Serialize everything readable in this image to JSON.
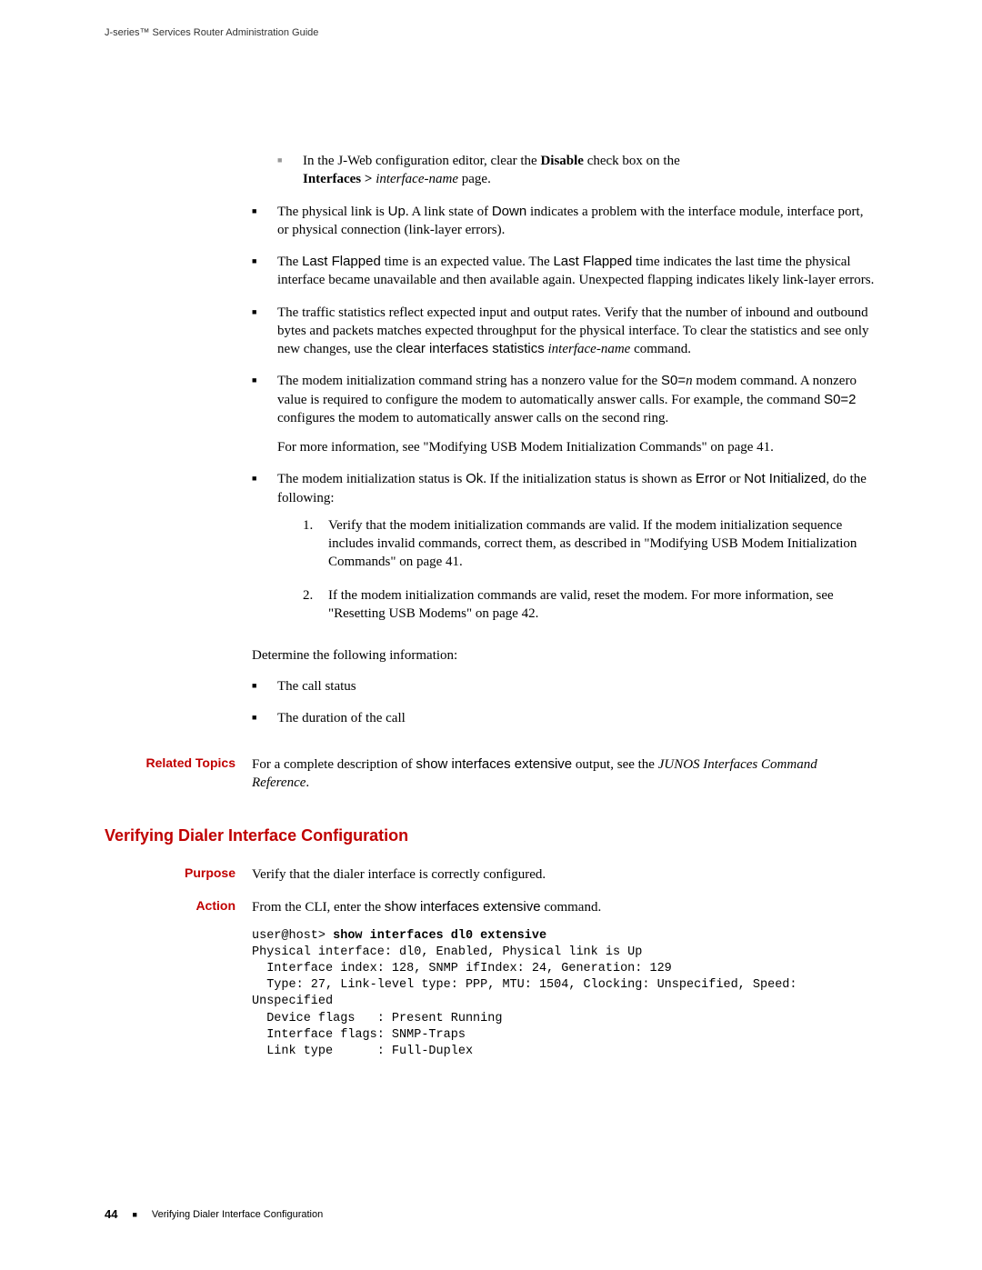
{
  "header": {
    "guide_title": "J-series™ Services Router Administration Guide"
  },
  "content": {
    "sub_bullet_prefix": "In the J-Web configuration editor, clear the ",
    "sub_bullet_disable": "Disable",
    "sub_bullet_mid": " check box on the ",
    "sub_bullet_interfaces": "Interfaces >",
    "sub_bullet_ifname": " interface-name",
    "sub_bullet_suffix": " page.",
    "bullet2_a": "The physical link is ",
    "bullet2_up": "Up",
    "bullet2_b": ". A link state of ",
    "bullet2_down": "Down",
    "bullet2_c": " indicates a problem with the interface module, interface port, or physical connection (link-layer errors).",
    "bullet3_a": "The ",
    "bullet3_lf": "Last Flapped",
    "bullet3_b": " time is an expected value. The ",
    "bullet3_lf2": "Last Flapped",
    "bullet3_c": " time indicates the last time the physical interface became unavailable and then available again. Unexpected flapping indicates likely link-layer errors.",
    "bullet4_a": "The traffic statistics reflect expected input and output rates. Verify that the number of inbound and outbound bytes and packets matches expected throughput for the physical interface. To clear the statistics and see only new changes, use the ",
    "bullet4_cmd": "clear interfaces statistics",
    "bullet4_ifname": " interface-name",
    "bullet4_b": " command.",
    "bullet5_a": "The modem initialization command string has a nonzero value for the ",
    "bullet5_s0": "S0=",
    "bullet5_n": "n",
    "bullet5_b": " modem command. A nonzero value is required to configure the modem to automatically answer calls. For example, the command ",
    "bullet5_s02": "S0=2",
    "bullet5_c": " configures the modem to automatically answer calls on the second ring.",
    "bullet5_para": "For more information, see \"Modifying USB Modem Initialization Commands\" on page 41.",
    "bullet6_a": "The modem initialization status is ",
    "bullet6_ok": "Ok",
    "bullet6_b": ". If the initialization status is shown as ",
    "bullet6_err": "Error",
    "bullet6_c": " or ",
    "bullet6_ni": "Not Initialized",
    "bullet6_d": ", do the following:",
    "num1": "1.",
    "num1_text": "Verify that the modem initialization commands are valid. If the modem initialization sequence includes invalid commands, correct them, as described in \"Modifying USB Modem Initialization Commands\" on page 41.",
    "num2": "2.",
    "num2_text": "If the modem initialization commands are valid, reset the modem. For more information, see \"Resetting USB Modems\" on page 42.",
    "determine": "Determine the following information:",
    "determine_b1": "The call status",
    "determine_b2": "The duration of the call",
    "related_label": "Related Topics",
    "related_a": "For a complete description of ",
    "related_cmd": "show interfaces extensive",
    "related_b": " output, see the ",
    "related_i": "JUNOS Interfaces Command Reference",
    "related_c": ".",
    "section_heading": "Verifying Dialer Interface Configuration",
    "purpose_label": "Purpose",
    "purpose_text": "Verify that the dialer interface is correctly configured.",
    "action_label": "Action",
    "action_a": "From the CLI, enter the ",
    "action_cmd": "show interfaces extensive",
    "action_b": " command.",
    "code_prompt": "user@host> ",
    "code_cmd": "show interfaces dl0 extensive",
    "code_body": "Physical interface: dl0, Enabled, Physical link is Up\n  Interface index: 128, SNMP ifIndex: 24, Generation: 129\n  Type: 27, Link-level type: PPP, MTU: 1504, Clocking: Unspecified, Speed:\nUnspecified\n  Device flags   : Present Running\n  Interface flags: SNMP-Traps\n  Link type      : Full-Duplex"
  },
  "footer": {
    "page_number": "44",
    "footer_text": "Verifying Dialer Interface Configuration"
  }
}
